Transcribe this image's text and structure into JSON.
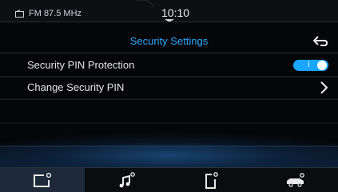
{
  "status": {
    "source": "FM 87.5 MHz",
    "source_icon": "radio-icon",
    "clock": "10:10"
  },
  "header": {
    "title": "Security Settings",
    "back_icon": "back-arrow-icon"
  },
  "settings": [
    {
      "label": "Security PIN Protection",
      "control": "toggle",
      "toggle_on": true,
      "toggle_text": "I"
    },
    {
      "label": "Change Security PIN",
      "control": "chevron"
    }
  ],
  "nav": [
    {
      "icon": "settings-screen-icon",
      "active": true
    },
    {
      "icon": "music-settings-icon",
      "active": false
    },
    {
      "icon": "phone-settings-icon",
      "active": false
    },
    {
      "icon": "car-settings-icon",
      "active": false
    }
  ],
  "colors": {
    "accent": "#1aa6ff",
    "title": "#2ea8ff",
    "background": "#050608"
  }
}
